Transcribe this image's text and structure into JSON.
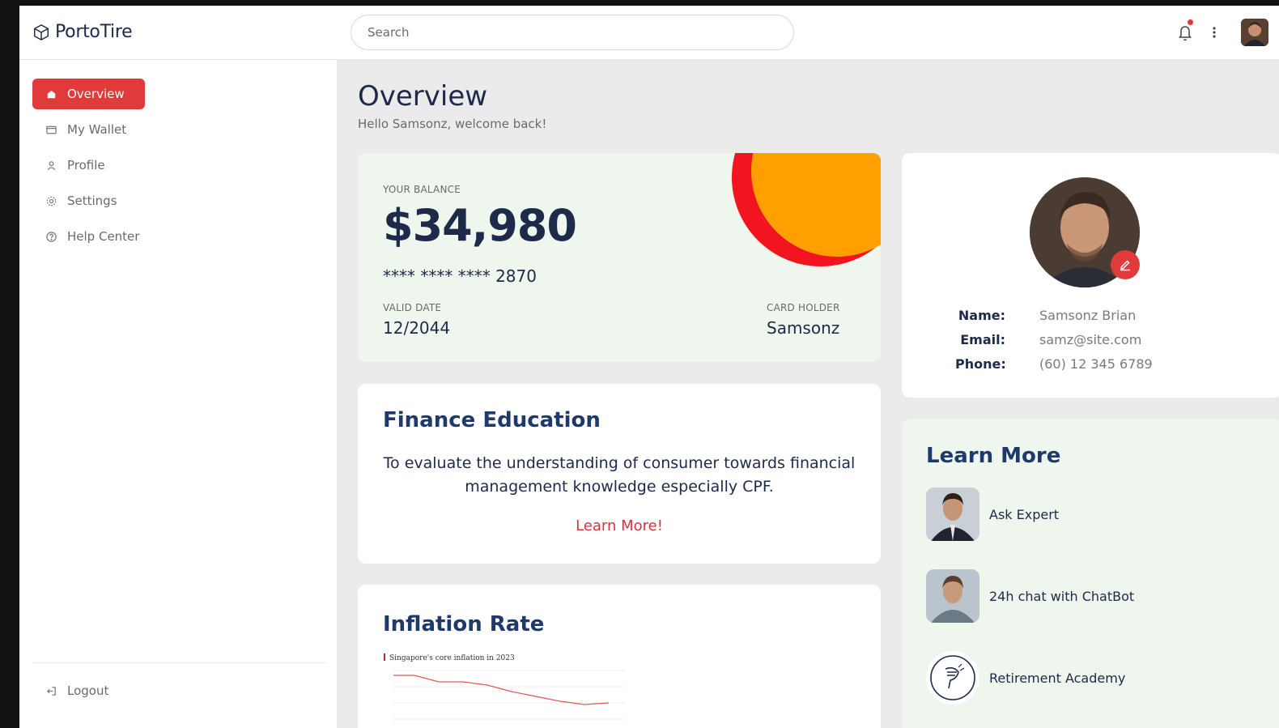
{
  "brand": {
    "name": "PortoTire"
  },
  "search": {
    "placeholder": "Search"
  },
  "sidebar": {
    "items": [
      {
        "label": "Overview",
        "icon": "home-icon"
      },
      {
        "label": "My Wallet",
        "icon": "wallet-icon"
      },
      {
        "label": "Profile",
        "icon": "user-icon"
      },
      {
        "label": "Settings",
        "icon": "gear-icon"
      },
      {
        "label": "Help Center",
        "icon": "help-icon"
      }
    ],
    "logout_label": "Logout"
  },
  "header": {
    "title": "Overview",
    "subtitle": "Hello Samsonz, welcome back!"
  },
  "balance": {
    "label": "YOUR BALANCE",
    "amount": "$34,980",
    "card_number": "**** **** **** 2870",
    "valid_label": "VALID DATE",
    "valid_value": "12/2044",
    "holder_label": "CARD HOLDER",
    "holder_value": "Samsonz"
  },
  "education": {
    "title": "Finance Education",
    "text": "To evaluate the understanding of consumer towards financial management knowledge especially CPF.",
    "link": "Learn More!"
  },
  "inflation": {
    "title": "Inflation Rate",
    "chart_title": "Singapore's core inflation in 2023"
  },
  "profile": {
    "name_label": "Name:",
    "name_value": "Samsonz Brian",
    "email_label": "Email:",
    "email_value": "samz@site.com",
    "phone_label": "Phone:",
    "phone_value": "(60) 12 345 6789"
  },
  "learn_more": {
    "title": "Learn More",
    "items": [
      {
        "label": "Ask Expert"
      },
      {
        "label": "24h chat with ChatBot"
      },
      {
        "label": "Retirement Academy"
      }
    ]
  },
  "colors": {
    "accent": "#e03a3a",
    "navy": "#1d2a4a",
    "card_green": "#eef6ee",
    "orange": "#ffa000"
  }
}
